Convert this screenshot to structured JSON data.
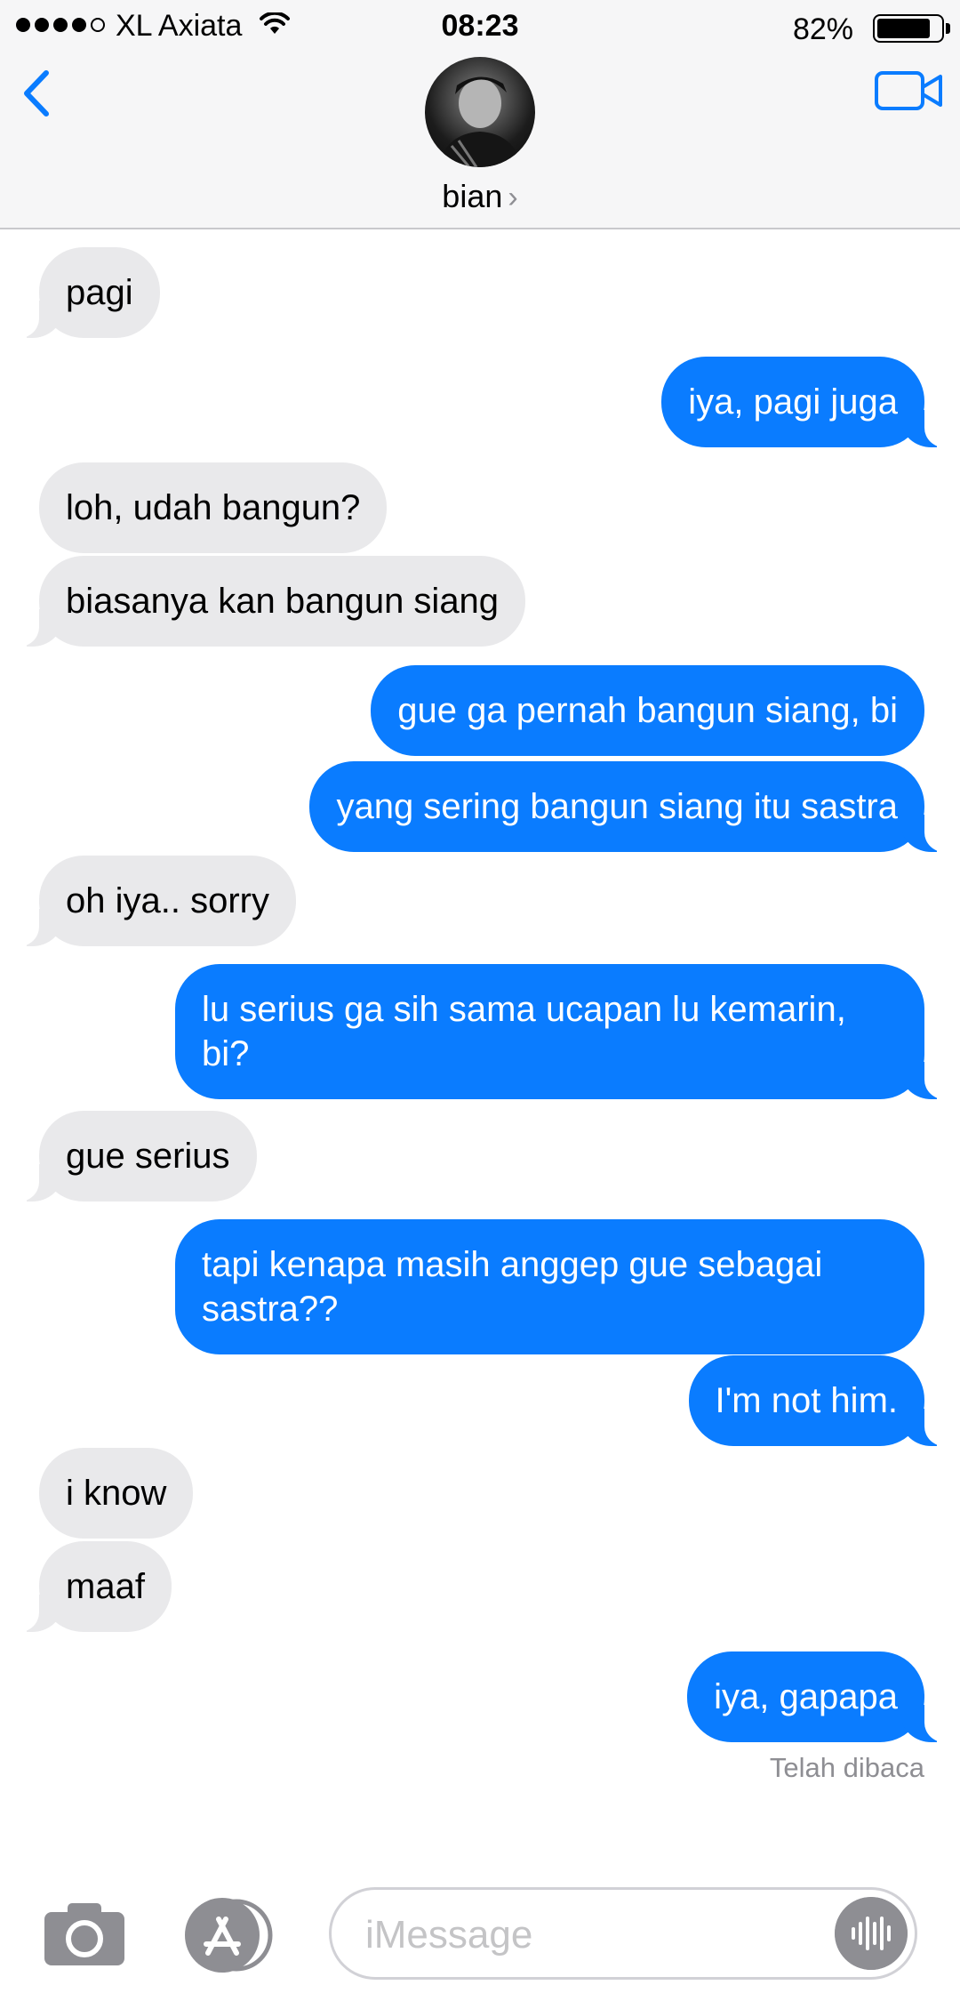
{
  "status_bar": {
    "carrier": "XL Axiata",
    "time": "08:23",
    "battery_percent": "82%",
    "battery_level": 0.82,
    "signal_bars": 4
  },
  "header": {
    "contact_name": "bian",
    "chevron": "›",
    "back_icon": "chevron-left-icon",
    "video_icon": "video-camera-icon",
    "accent_color": "#0a7cff"
  },
  "messages": [
    {
      "side": "in",
      "text": "pagi"
    },
    {
      "side": "out",
      "text": "iya, pagi juga"
    },
    {
      "side": "in",
      "text": "loh, udah bangun?"
    },
    {
      "side": "in",
      "text": "biasanya kan bangun siang"
    },
    {
      "side": "out",
      "text": "gue ga pernah bangun siang, bi"
    },
    {
      "side": "out",
      "text": "yang sering bangun siang itu sastra"
    },
    {
      "side": "in",
      "text": "oh iya.. sorry"
    },
    {
      "side": "out",
      "text": "lu serius ga sih sama ucapan lu kemarin,\nbi?"
    },
    {
      "side": "in",
      "text": "gue serius"
    },
    {
      "side": "out",
      "text": "tapi kenapa masih anggep gue sebagai\nsastra??"
    },
    {
      "side": "out",
      "text": "I'm not him."
    },
    {
      "side": "in",
      "text": "i know"
    },
    {
      "side": "in",
      "text": "maaf"
    },
    {
      "side": "out",
      "text": "iya, gapapa"
    }
  ],
  "read_receipt": "Telah dibaca",
  "input_bar": {
    "placeholder": "iMessage",
    "camera_icon": "camera-icon",
    "appstore_icon": "app-store-icon",
    "audio_icon": "audio-waveform-icon"
  }
}
